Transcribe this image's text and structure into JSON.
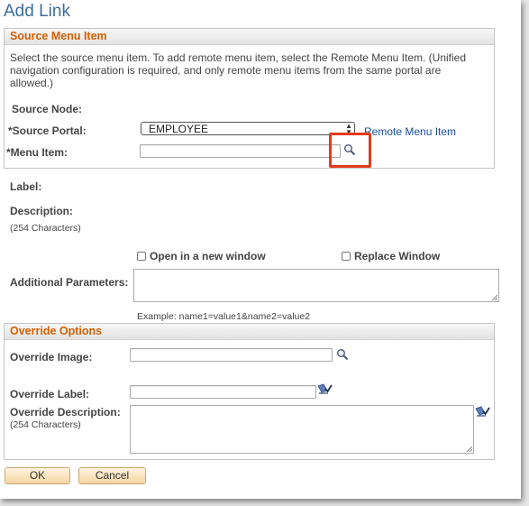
{
  "page": {
    "title": "Add Link"
  },
  "source_section": {
    "title": "Source Menu Item",
    "instructions": "Select the source menu item. To add remote menu item, select the Remote Menu Item. (Unified navigation configuration is required, and only remote menu items from the same portal are allowed.)",
    "source_node_label": "Source Node:",
    "source_portal_label": "*Source Portal:",
    "source_portal_value": "EMPLOYEE",
    "remote_menu_item_link": "Remote Menu Item",
    "menu_item_label": "*Menu Item:",
    "menu_item_value": ""
  },
  "main": {
    "label_label": "Label:",
    "description_label": "Description:",
    "description_hint": "(254 Characters)",
    "open_new_window_label": "Open in a new window",
    "open_new_window_checked": false,
    "replace_window_label": "Replace Window",
    "replace_window_checked": false,
    "additional_params_label": "Additional Parameters:",
    "additional_params_value": "",
    "example_text": "Example: name1=value1&name2=value2"
  },
  "override_section": {
    "title": "Override Options",
    "override_image_label": "Override Image:",
    "override_label_label": "Override Label:",
    "override_description_label": "Override Description:",
    "override_description_hint": "(254 Characters)"
  },
  "buttons": {
    "ok": "OK",
    "cancel": "Cancel"
  },
  "colors": {
    "title": "#3e6d9b",
    "section_title": "#d45f00",
    "link": "#1a4fa0",
    "highlight": "#e23b1d",
    "button_bg": "#f6d4a1"
  }
}
